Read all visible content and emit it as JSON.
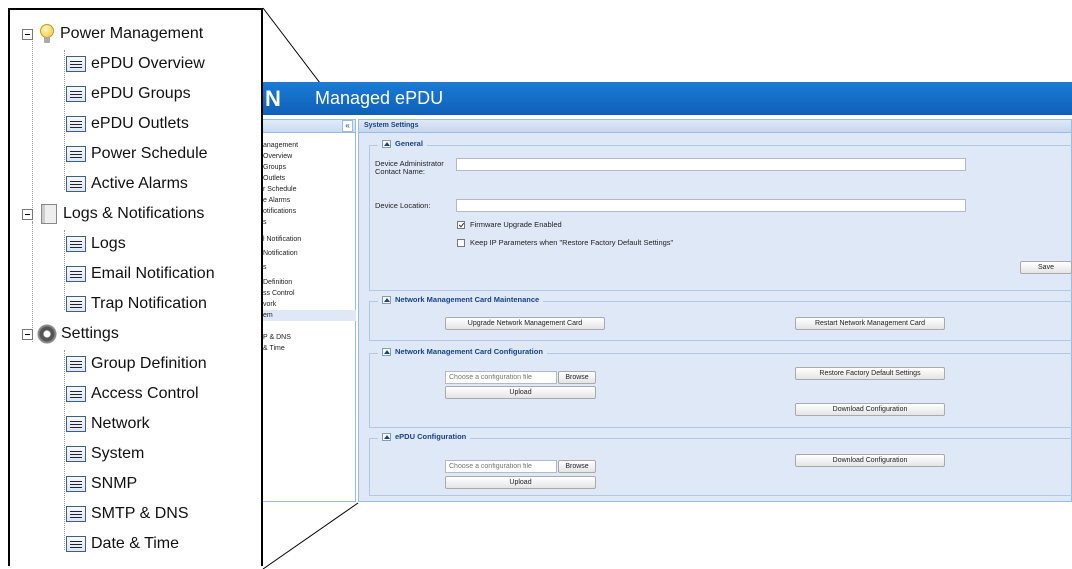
{
  "zoom_tree": {
    "power_management": "Power Management",
    "epdu_overview": "ePDU Overview",
    "epdu_groups": "ePDU Groups",
    "epdu_outlets": "ePDU Outlets",
    "power_schedule": "Power Schedule",
    "active_alarms": "Active Alarms",
    "logs_notifications": "Logs & Notifications",
    "logs": "Logs",
    "email_notification": "Email Notification",
    "trap_notification": "Trap Notification",
    "settings": "Settings",
    "group_definition": "Group Definition",
    "access_control": "Access Control",
    "network": "Network",
    "system": "System",
    "snmp": "SNMP",
    "smtp_dns": "SMTP & DNS",
    "date_time": "Date & Time"
  },
  "header": {
    "logo_fragment": "N",
    "title": "Managed ePDU"
  },
  "sidebar": {
    "collapse": "«",
    "items": [
      "anagement",
      " Overview",
      " Groups",
      " Outlets",
      "r Schedule",
      "e Alarms",
      "otifications",
      "s",
      "l Notification",
      " Notification",
      "s",
      " Definition",
      "ss Control",
      "vork",
      "em",
      "",
      "P & DNS",
      "& Time"
    ]
  },
  "content": {
    "title": "System Settings",
    "general": {
      "legend": "General",
      "contact_label": "Device Administrator Contact Name:",
      "contact_value": "",
      "location_label": "Device Location:",
      "location_value": "",
      "firmware_label": "Firmware Upgrade Enabled",
      "firmware_checked": true,
      "keepip_label": "Keep IP Parameters when \"Restore Factory Default Settings\"",
      "keepip_checked": false,
      "save": "Save"
    },
    "nmc_maintenance": {
      "legend": "Network Management Card Maintenance",
      "upgrade": "Upgrade Network Management Card",
      "restart": "Restart Network Management Card"
    },
    "nmc_configuration": {
      "legend": "Network Management Card Configuration",
      "file_placeholder": "Choose a configuration file",
      "browse": "Browse",
      "upload": "Upload",
      "restore": "Restore Factory Default Settings",
      "download": "Download Configuration"
    },
    "epdu_configuration": {
      "legend": "ePDU Configuration",
      "file_placeholder": "Choose a configuration file",
      "browse": "Browse",
      "upload": "Upload",
      "download": "Download Configuration"
    }
  }
}
